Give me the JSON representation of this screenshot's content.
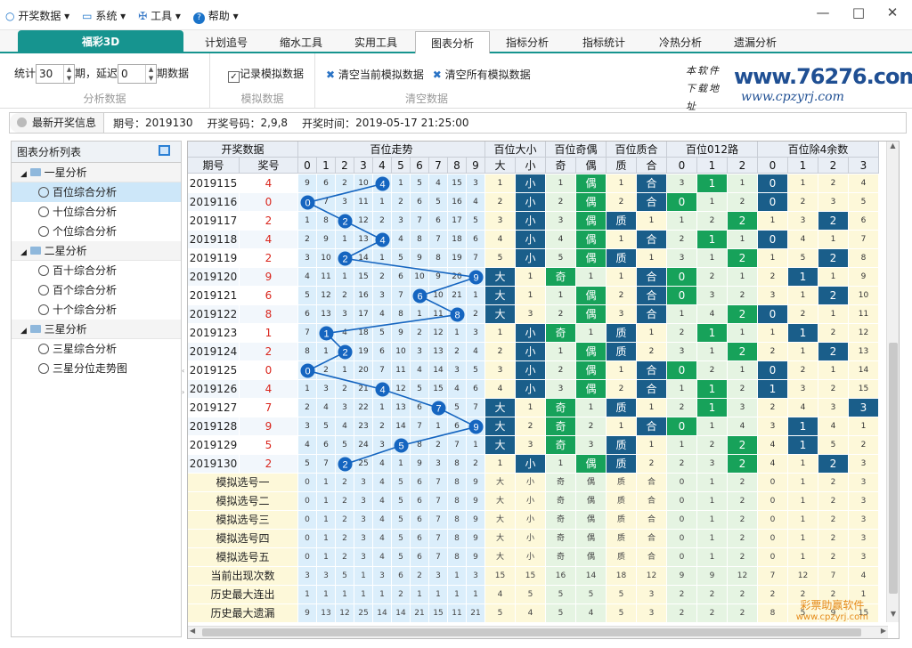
{
  "menu": [
    {
      "label": "开奖数据",
      "icon": "circle-icon"
    },
    {
      "label": "系统",
      "icon": "monitor-icon"
    },
    {
      "label": "工具",
      "icon": "tools-icon"
    },
    {
      "label": "帮助",
      "icon": "help-icon"
    }
  ],
  "window": {
    "minimize": "—",
    "maximize": "□",
    "close": "✕"
  },
  "tabs": {
    "brand": "福彩3D",
    "items": [
      "计划追号",
      "缩水工具",
      "实用工具",
      "图表分析",
      "指标分析",
      "指标统计",
      "冷热分析",
      "遗漏分析"
    ],
    "active": 3
  },
  "toolbar": {
    "stat_label": "统计",
    "stat_value": "30",
    "period_label": "期，延迟",
    "delay_value": "0",
    "period_data_label": "期数据",
    "analysis_caption": "分析数据",
    "record_label": "记录模拟数据",
    "sim_caption": "模拟数据",
    "clear_current": "清空当前模拟数据",
    "clear_all": "清空所有模拟数据",
    "clear_caption": "清空数据",
    "logo_text": "www.76276.com",
    "logo_sub": "www.cpzyrj.com",
    "logo_hand": "本软件 下载地址"
  },
  "info": {
    "btn": "最新开奖信息",
    "issue_label": "期号：",
    "issue": "2019130",
    "nums_label": "开奖号码：",
    "nums": "2,9,8",
    "time_label": "开奖时间：",
    "time": "2019-05-17 21:25:00"
  },
  "tree": {
    "header": "图表分析列表",
    "groups": [
      {
        "label": "一星分析",
        "items": [
          "百位综合分析",
          "十位综合分析",
          "个位综合分析"
        ]
      },
      {
        "label": "二星分析",
        "items": [
          "百十综合分析",
          "百个综合分析",
          "十个综合分析"
        ]
      },
      {
        "label": "三星分析",
        "items": [
          "三星综合分析",
          "三星分位走势图"
        ]
      }
    ],
    "selected": "百位综合分析"
  },
  "grid": {
    "group_headers": [
      "开奖数据",
      "百位走势",
      "百位大小",
      "百位奇偶",
      "百位质合",
      "百位012路",
      "百位除4余数"
    ],
    "sub_headers": [
      "期号",
      "奖号",
      "0",
      "1",
      "2",
      "3",
      "4",
      "5",
      "6",
      "7",
      "8",
      "9",
      "大",
      "小",
      "奇",
      "偶",
      "质",
      "合",
      "0",
      "1",
      "2",
      "0",
      "1",
      "2",
      "3"
    ],
    "rows": [
      [
        "2019115",
        "4",
        "9",
        "6",
        "2",
        "10",
        "4",
        "1",
        "5",
        "4",
        "15",
        "3",
        "1",
        "小",
        "1",
        "偶",
        "1",
        "合",
        "3",
        "1",
        "1",
        "0",
        "1",
        "2",
        "4"
      ],
      [
        "2019116",
        "0",
        "0",
        "7",
        "3",
        "11",
        "1",
        "2",
        "6",
        "5",
        "16",
        "4",
        "2",
        "小",
        "2",
        "偶",
        "2",
        "合",
        "0",
        "1",
        "2",
        "0",
        "2",
        "3",
        "5"
      ],
      [
        "2019117",
        "2",
        "1",
        "8",
        "2",
        "12",
        "2",
        "3",
        "7",
        "6",
        "17",
        "5",
        "3",
        "小",
        "3",
        "偶",
        "质",
        "1",
        "1",
        "2",
        "2",
        "1",
        "3",
        "2",
        "6"
      ],
      [
        "2019118",
        "4",
        "2",
        "9",
        "1",
        "13",
        "4",
        "4",
        "8",
        "7",
        "18",
        "6",
        "4",
        "小",
        "4",
        "偶",
        "1",
        "合",
        "2",
        "1",
        "1",
        "0",
        "4",
        "1",
        "7"
      ],
      [
        "2019119",
        "2",
        "3",
        "10",
        "2",
        "14",
        "1",
        "5",
        "9",
        "8",
        "19",
        "7",
        "5",
        "小",
        "5",
        "偶",
        "质",
        "1",
        "3",
        "1",
        "2",
        "1",
        "5",
        "2",
        "8"
      ],
      [
        "2019120",
        "9",
        "4",
        "11",
        "1",
        "15",
        "2",
        "6",
        "10",
        "9",
        "20",
        "9",
        "大",
        "1",
        "奇",
        "1",
        "1",
        "合",
        "0",
        "2",
        "1",
        "2",
        "1",
        "1",
        "9"
      ],
      [
        "2019121",
        "6",
        "5",
        "12",
        "2",
        "16",
        "3",
        "7",
        "6",
        "10",
        "21",
        "1",
        "大",
        "1",
        "1",
        "偶",
        "2",
        "合",
        "0",
        "3",
        "2",
        "3",
        "1",
        "2",
        "10"
      ],
      [
        "2019122",
        "8",
        "6",
        "13",
        "3",
        "17",
        "4",
        "8",
        "1",
        "11",
        "8",
        "2",
        "大",
        "3",
        "2",
        "偶",
        "3",
        "合",
        "1",
        "4",
        "2",
        "0",
        "2",
        "1",
        "11"
      ],
      [
        "2019123",
        "1",
        "7",
        "1",
        "4",
        "18",
        "5",
        "9",
        "2",
        "12",
        "1",
        "3",
        "1",
        "小",
        "奇",
        "1",
        "质",
        "1",
        "2",
        "1",
        "1",
        "1",
        "1",
        "2",
        "12"
      ],
      [
        "2019124",
        "2",
        "8",
        "1",
        "2",
        "19",
        "6",
        "10",
        "3",
        "13",
        "2",
        "4",
        "2",
        "小",
        "1",
        "偶",
        "质",
        "2",
        "3",
        "1",
        "2",
        "2",
        "1",
        "2",
        "13"
      ],
      [
        "2019125",
        "0",
        "0",
        "2",
        "1",
        "20",
        "7",
        "11",
        "4",
        "14",
        "3",
        "5",
        "3",
        "小",
        "2",
        "偶",
        "1",
        "合",
        "0",
        "2",
        "1",
        "0",
        "2",
        "1",
        "14"
      ],
      [
        "2019126",
        "4",
        "1",
        "3",
        "2",
        "21",
        "4",
        "12",
        "5",
        "15",
        "4",
        "6",
        "4",
        "小",
        "3",
        "偶",
        "2",
        "合",
        "1",
        "1",
        "2",
        "1",
        "3",
        "2",
        "15"
      ],
      [
        "2019127",
        "7",
        "2",
        "4",
        "3",
        "22",
        "1",
        "13",
        "6",
        "7",
        "5",
        "7",
        "大",
        "1",
        "奇",
        "1",
        "质",
        "1",
        "2",
        "1",
        "3",
        "2",
        "4",
        "3",
        "3"
      ],
      [
        "2019128",
        "9",
        "3",
        "5",
        "4",
        "23",
        "2",
        "14",
        "7",
        "1",
        "6",
        "9",
        "大",
        "2",
        "奇",
        "2",
        "1",
        "合",
        "0",
        "1",
        "4",
        "3",
        "1",
        "4",
        "1"
      ],
      [
        "2019129",
        "5",
        "4",
        "6",
        "5",
        "24",
        "3",
        "5",
        "8",
        "2",
        "7",
        "1",
        "大",
        "3",
        "奇",
        "3",
        "质",
        "1",
        "1",
        "2",
        "2",
        "4",
        "1",
        "5",
        "2"
      ],
      [
        "2019130",
        "2",
        "5",
        "7",
        "2",
        "25",
        "4",
        "1",
        "9",
        "3",
        "8",
        "2",
        "1",
        "小",
        "1",
        "偶",
        "质",
        "2",
        "2",
        "3",
        "2",
        "4",
        "1",
        "2",
        "3"
      ]
    ],
    "sim_rows": [
      {
        "label": "模拟选号一",
        "vals": [
          "0",
          "1",
          "2",
          "3",
          "4",
          "5",
          "6",
          "7",
          "8",
          "9",
          "大",
          "小",
          "奇",
          "偶",
          "质",
          "合",
          "0",
          "1",
          "2",
          "0",
          "1",
          "2",
          "3"
        ]
      },
      {
        "label": "模拟选号二",
        "vals": [
          "0",
          "1",
          "2",
          "3",
          "4",
          "5",
          "6",
          "7",
          "8",
          "9",
          "大",
          "小",
          "奇",
          "偶",
          "质",
          "合",
          "0",
          "1",
          "2",
          "0",
          "1",
          "2",
          "3"
        ]
      },
      {
        "label": "模拟选号三",
        "vals": [
          "0",
          "1",
          "2",
          "3",
          "4",
          "5",
          "6",
          "7",
          "8",
          "9",
          "大",
          "小",
          "奇",
          "偶",
          "质",
          "合",
          "0",
          "1",
          "2",
          "0",
          "1",
          "2",
          "3"
        ]
      },
      {
        "label": "模拟选号四",
        "vals": [
          "0",
          "1",
          "2",
          "3",
          "4",
          "5",
          "6",
          "7",
          "8",
          "9",
          "大",
          "小",
          "奇",
          "偶",
          "质",
          "合",
          "0",
          "1",
          "2",
          "0",
          "1",
          "2",
          "3"
        ]
      },
      {
        "label": "模拟选号五",
        "vals": [
          "0",
          "1",
          "2",
          "3",
          "4",
          "5",
          "6",
          "7",
          "8",
          "9",
          "大",
          "小",
          "奇",
          "偶",
          "质",
          "合",
          "0",
          "1",
          "2",
          "0",
          "1",
          "2",
          "3"
        ]
      }
    ],
    "stat_rows": [
      {
        "label": "当前出现次数",
        "vals": [
          "3",
          "3",
          "5",
          "1",
          "3",
          "6",
          "2",
          "3",
          "1",
          "3",
          "15",
          "15",
          "16",
          "14",
          "18",
          "12",
          "9",
          "9",
          "12",
          "7",
          "12",
          "7",
          "4"
        ]
      },
      {
        "label": "历史最大连出",
        "vals": [
          "1",
          "1",
          "1",
          "1",
          "1",
          "2",
          "1",
          "1",
          "1",
          "1",
          "4",
          "5",
          "5",
          "5",
          "5",
          "3",
          "2",
          "2",
          "2",
          "2",
          "2",
          "2",
          "1"
        ]
      },
      {
        "label": "历史最大遗漏",
        "vals": [
          "9",
          "13",
          "12",
          "25",
          "14",
          "14",
          "21",
          "15",
          "11",
          "21",
          "5",
          "4",
          "5",
          "4",
          "5",
          "3",
          "2",
          "2",
          "2",
          "8",
          "5",
          "9",
          "15"
        ]
      }
    ],
    "colors": {
      "accent": "#16948f",
      "ball": "#1565c0",
      "dark_blue": "#1a5e8a",
      "green": "#17a25a",
      "light_blue": "#dbeefb",
      "light_yellow": "#fdf8d9",
      "light_green": "#e5f4e2",
      "row_alt": "#eef6fc"
    }
  },
  "watermark": {
    "line1": "彩票助赢软件",
    "line2": "www.cpzyrj.com"
  }
}
